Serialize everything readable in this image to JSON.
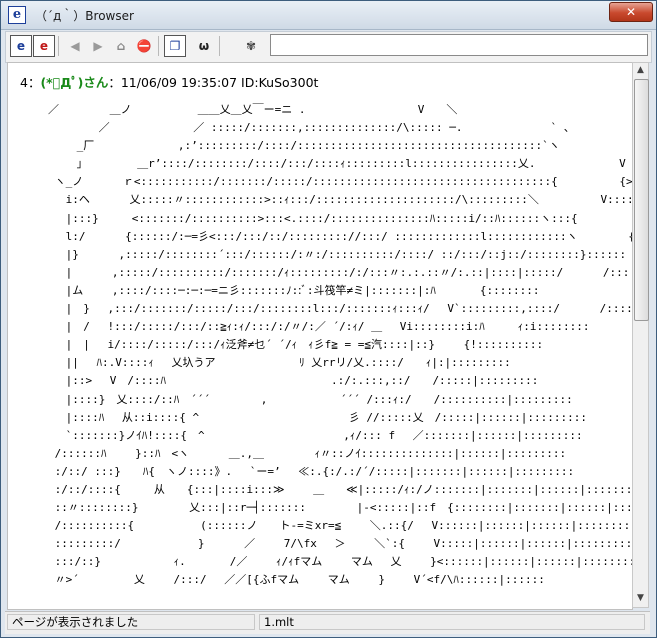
{
  "window": {
    "title": "（´д｀）Browser",
    "close_label": "✕"
  },
  "toolbar": {
    "buttons": [
      {
        "name": "ie-icon",
        "glyph": "e"
      },
      {
        "name": "ie-red-icon",
        "glyph": "e"
      },
      {
        "name": "back-icon",
        "glyph": "◀"
      },
      {
        "name": "forward-icon",
        "glyph": "▶"
      },
      {
        "name": "home-icon",
        "glyph": "⌂"
      },
      {
        "name": "stop-icon",
        "glyph": "⛔"
      },
      {
        "name": "copy-icon",
        "glyph": "❐"
      },
      {
        "name": "mona-icon",
        "glyph": "ω"
      },
      {
        "name": "settings-icon",
        "glyph": "✾"
      }
    ],
    "url_value": ""
  },
  "post": {
    "number": "4",
    "separator": "：",
    "name": "(*ﾟДﾟ)さん",
    "meta": "：11/06/09 19:35:07 ID:KuSo300t"
  },
  "ascii_art": "／　　　　 ＿ノ　　　　　　＿＿乂＿乂￣ー=ニ . 　　　　　　　　　 V　　＼\n　　　　 ／　　　　　　　 ／ :::::/:::::::,::::::::::::::/\\::::: ─.　　　　　　　　` 、\n　　 _厂　　　　　　　 ,:’:::::::::/::::/:::::::::::::::::::::::::::::::::::::`ヽ　　　　　　　 }\n　　 」　　　　　＿r’::::/::::::::/::::/:::/::::ｨ:::::::::l::::::::::::::::乂.　　　　　　　 V\n ヽ_ノ　　　 ｒ<:::::::::::/:::::::/:::::/::::::::::::::::::::::::::::::::::::{　　　　　 {>.´\n　 i:ヘ　　　 乂:::::〃::::::::::::>::ｨ:::/:::::::::::::::::::::/\\:::::::::＼　　　　　 V::::\n　 |:::}　　　<:::::::/::::::::::>:::<.::::/:::::::::::::::ﾊ:::::i/::ﾊ::::::ヽ:::{　　　　　{::::::\n　 l:/　　　 {::::::/:─=彡<:::/:::/::/::::::::://:::/ :::::::::::::l::::::::::::ヽ　　　　 {::::::\n　 |}　　　 ,:::::/::::::::´:::/::::::/:〃:/::::::::::/::::/ ::/:::/::j::/::::::::}::::::　　　 }:::::\n　 |　　　 ,:::::/::::::::::/:::::::/ｨ:::::::::/:/:::〃:.:.::〃/:.::|::::|:::::/　　　 /::::::\n　 |ム　　 ,::::/::::─:─:─=ニ彡:::::::ﾉ::ﾞ:斗筏竿≠ミ|:::::::|:ﾊ　　　　{::::::::\n　 |　}　 ,:::/:::::::/:::::/:::/::::::::l:::/:::::::ｨ:::ｨ/　 V`:::::::::,::::/　　　 /::::::::\n　 |　/　 !:::/:::::/:::/::≧ｨ:ｨ/:::/:/〃/:／ ´/:ｨ/ ＿　 Vi::::::::i:ﾊ　　　ｨ:i::::::::\n　 |　|　 i/::::/:::::/:::/ｨ泛斧≠乜´ ´/ｨ　ｨ彡f≧ = =≦汽::::|::}　　 {!::::::::::\n　 ||　 ﾊ:.V::::ｨ　 乂圦うア　　　　　　　 ﾘ 乂rrリ/乂.::::/　　ｨ|:|:::::::::\n　 |::>　 V　/::::ﾊ　　　　　　　　　　　　　　　.:/:.:::,::/　　/:::::|:::::::::\n　 |::::}　乂::::/::ﾊ　´´´　　　　 ,　　　　　　 ´´´ /:::ｨ:/　　/::::::::::|:::::::::\n　 |::::ﾊ　 从::i::::{ ^　　　　　　　　　　　　　 彡 //:::::乂　/:::::|::::::|:::::::::\n　 `:::::::}ノｲﾊ!::::{　^　　　　　　　　　　　　 ,ｨ/::: f　 ／:::::::|::::::|:::::::::\n /::::::ﾊ　　 }::ﾊ　<ヽ　　　 ＿.,＿　　　　 ｨ〃::ノｲ::::::::::::::|::::::|:::::::::\n :/::/ :::}　　ﾊ{　ヽノ::::》.　 `ー=’　 ≪:.{:/.:/´/:::::|:::::::|::::::|:::::::::\n :/::/::::{　　　从　　{:::|::::i:::≫　　 ＿　　≪|:::::/ｨ:/ノ:::::::|:::::::|::::::|:::::::::\n ::〃::::::::}　　　　 乂:::|::r─┤:::::::　　　　 |-<:::::|::f　{::::::::|:::::::|::::::|:::::::::\n /::::::::::{　　　　　　(::::::ノ　　ト-=ミxr=≦　　 ＼.::{/　 V::::::|::::::|::::::|:::::::::\n :::::::::/　　　　　　　}　　　 ／　　 7/\\fx　 ＞　　 ＼`:{　　 V:::::|::::::|::::::|:::::::::\n :::/::}　　　　　　 ｨ.　　　　/／　　 ｨ/ｨfマム　　 マム　 乂　　 }<::::::|::::::|::::::|:::::::::\n 〃>´　　　　　乂　　 /:::/　 ／／[{ふfマム　　 マム　　 }　　 V´<f/\\ﾊ::::::|::::::",
  "status": {
    "left": "ページが表示されました",
    "right": "1.mlt"
  }
}
